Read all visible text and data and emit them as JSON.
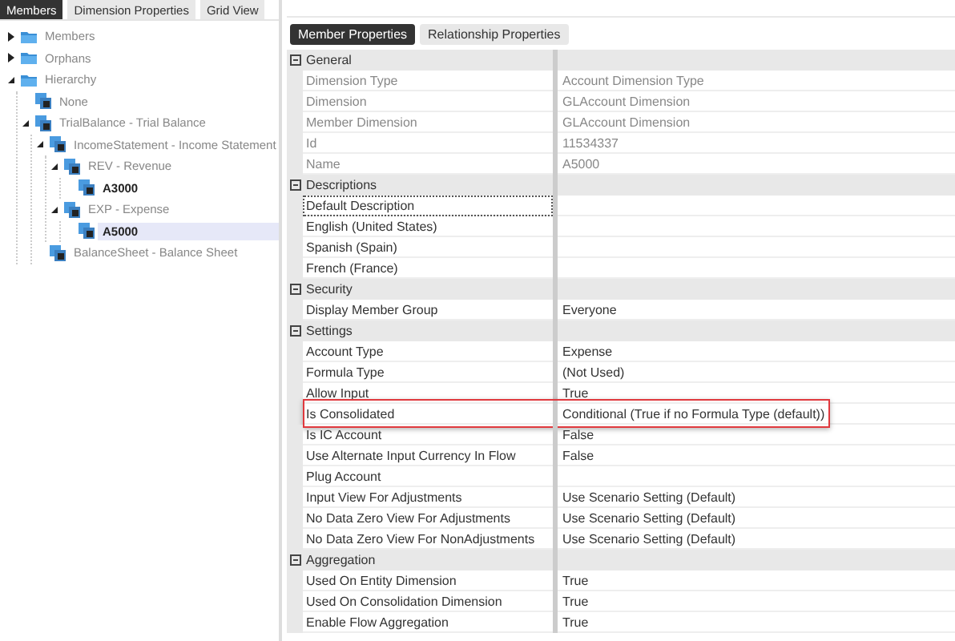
{
  "left_tabs": [
    {
      "label": "Members",
      "selected": true
    },
    {
      "label": "Dimension Properties",
      "selected": false
    },
    {
      "label": "Grid View",
      "selected": false
    }
  ],
  "tree": [
    {
      "label": "Members",
      "kind": "folder",
      "expanded": false,
      "selected": false
    },
    {
      "label": "Orphans",
      "kind": "folder",
      "expanded": false,
      "selected": false
    },
    {
      "label": "Hierarchy",
      "kind": "folder",
      "expanded": true,
      "selected": false,
      "children": [
        {
          "label": "None",
          "kind": "member",
          "selected": false
        },
        {
          "label": "TrialBalance - Trial Balance",
          "kind": "member",
          "expanded": true,
          "selected": false,
          "children": [
            {
              "label": "IncomeStatement - Income Statement",
              "kind": "member",
              "expanded": true,
              "selected": false,
              "children": [
                {
                  "label": "REV - Revenue",
                  "kind": "member",
                  "expanded": true,
                  "selected": false,
                  "children": [
                    {
                      "label": "A3000",
                      "kind": "base-member",
                      "selected": false
                    }
                  ]
                },
                {
                  "label": "EXP - Expense",
                  "kind": "member",
                  "expanded": true,
                  "selected": false,
                  "children": [
                    {
                      "label": "A5000",
                      "kind": "base-member",
                      "selected": true
                    }
                  ]
                }
              ]
            },
            {
              "label": "BalanceSheet - Balance Sheet",
              "kind": "member",
              "selected": false
            }
          ]
        }
      ]
    }
  ],
  "right_tabs": [
    {
      "label": "Member Properties",
      "selected": true
    },
    {
      "label": "Relationship Properties",
      "selected": false
    }
  ],
  "categories": [
    {
      "name": "General",
      "expanded": true,
      "rows": [
        {
          "name": "Dimension Type",
          "value": "Account Dimension Type",
          "readonly": true,
          "focused": false,
          "highlighted": false
        },
        {
          "name": "Dimension",
          "value": "GLAccount Dimension",
          "readonly": true,
          "focused": false,
          "highlighted": false
        },
        {
          "name": "Member Dimension",
          "value": "GLAccount Dimension",
          "readonly": true,
          "focused": false,
          "highlighted": false
        },
        {
          "name": "Id",
          "value": "11534337",
          "readonly": true,
          "focused": false,
          "highlighted": false
        },
        {
          "name": "Name",
          "value": "A5000",
          "readonly": true,
          "focused": false,
          "highlighted": false
        }
      ]
    },
    {
      "name": "Descriptions",
      "expanded": true,
      "rows": [
        {
          "name": "Default Description",
          "readonly": false,
          "focused": true,
          "highlighted": false
        },
        {
          "name": "English (United States)",
          "readonly": false,
          "focused": false,
          "highlighted": false
        },
        {
          "name": "Spanish (Spain)",
          "readonly": false,
          "focused": false,
          "highlighted": false
        },
        {
          "name": "French (France)",
          "readonly": false,
          "focused": false,
          "highlighted": false
        }
      ]
    },
    {
      "name": "Security",
      "expanded": true,
      "rows": [
        {
          "name": "Display Member Group",
          "value": "Everyone",
          "readonly": false,
          "focused": false,
          "highlighted": false
        }
      ]
    },
    {
      "name": "Settings",
      "expanded": true,
      "rows": [
        {
          "name": "Account Type",
          "value": "Expense",
          "readonly": false,
          "focused": false,
          "highlighted": false
        },
        {
          "name": "Formula Type",
          "value": "(Not Used)",
          "readonly": false,
          "focused": false,
          "highlighted": false
        },
        {
          "name": "Allow Input",
          "value": "True",
          "readonly": false,
          "focused": false,
          "highlighted": false
        },
        {
          "name": "Is Consolidated",
          "value": "Conditional (True if no Formula Type (default))",
          "readonly": false,
          "focused": false,
          "highlighted": true
        },
        {
          "name": "Is IC Account",
          "value": "False",
          "readonly": false,
          "focused": false,
          "highlighted": false
        },
        {
          "name": "Use Alternate Input Currency In Flow",
          "value": "False",
          "readonly": false,
          "focused": false,
          "highlighted": false
        },
        {
          "name": "Plug Account",
          "readonly": false,
          "focused": false,
          "highlighted": false
        },
        {
          "name": "Input View For Adjustments",
          "value": "Use Scenario Setting (Default)",
          "readonly": false,
          "focused": false,
          "highlighted": false
        },
        {
          "name": "No Data Zero View For Adjustments",
          "value": "Use Scenario Setting (Default)",
          "readonly": false,
          "focused": false,
          "highlighted": false
        },
        {
          "name": "No Data Zero View For NonAdjustments",
          "value": "Use Scenario Setting (Default)",
          "readonly": false,
          "focused": false,
          "highlighted": false
        }
      ]
    },
    {
      "name": "Aggregation",
      "expanded": true,
      "rows": [
        {
          "name": "Used On Entity Dimension",
          "value": "True",
          "readonly": false,
          "focused": false,
          "highlighted": false
        },
        {
          "name": "Used On Consolidation Dimension",
          "value": "True",
          "readonly": false,
          "focused": false,
          "highlighted": false
        },
        {
          "name": "Enable Flow Aggregation",
          "value": "True",
          "readonly": false,
          "focused": false,
          "highlighted": false
        }
      ]
    }
  ]
}
